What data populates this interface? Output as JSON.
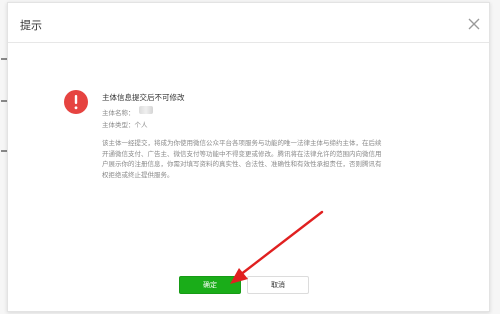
{
  "dialog": {
    "title": "提示",
    "close_icon": "close-icon"
  },
  "notice": {
    "icon": "exclamation-circle-icon",
    "icon_color": "#e64340",
    "headline": "主体信息提交后不可修改",
    "subject_name_label": "主体名称：",
    "subject_type_label": "主体类型：",
    "subject_type_value": "个人",
    "description": "该主体一经提交，将成为你使用微信公众平台各项服务与功能的唯一法律主体与缔约主体，在后续开通微信支付、广告主、微信支付等功能中不得变更或修改。腾讯将在法律允许的范围内向微信用户展示你的注册信息，你需对填写资料的真实性、合法性、准确性和有效性承担责任，否则腾讯有权拒绝或终止提供服务。"
  },
  "buttons": {
    "confirm_label": "确定",
    "cancel_label": "取消"
  },
  "colors": {
    "primary": "#1aad19",
    "annotation_arrow": "#e02020"
  }
}
